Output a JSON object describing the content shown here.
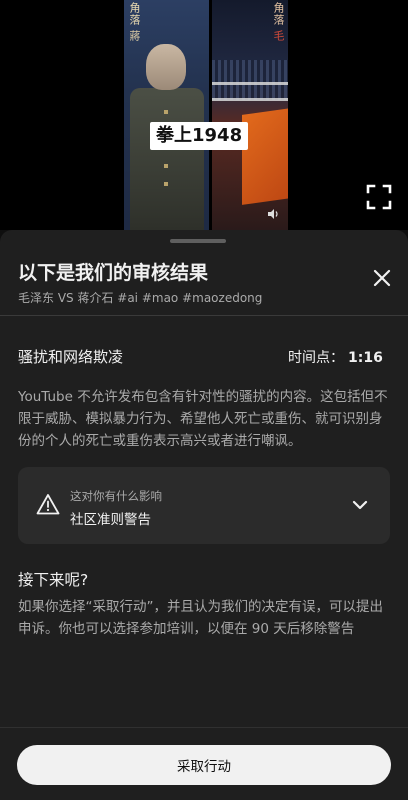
{
  "video": {
    "caption": "拳上1948",
    "left_side_text_top": "角落",
    "left_side_text_mid": "蔣",
    "right_side_text_top": "角落",
    "right_side_text_mid": "毛",
    "fullscreen_icon": "fullscreen-icon",
    "volume_icon": "volume-icon"
  },
  "sheet": {
    "title": "以下是我们的审核结果",
    "subtitle": "毛泽东 VS 蒋介石 #ai #mao #maozedong",
    "close_icon": "close-icon"
  },
  "violation": {
    "title": "骚扰和网络欺凌",
    "timestamp_label": "时间点：",
    "timestamp_value": "1:16",
    "description": "YouTube 不允许发布包含有针对性的骚扰的内容。这包括但不限于威胁、模拟暴力行为、希望他人死亡或重伤、就可识别身份的个人的死亡或重伤表示高兴或者进行嘲讽。"
  },
  "impact": {
    "question": "这对你有什么影响",
    "answer": "社区准则警告",
    "icon": "warning-icon",
    "expand_icon": "chevron-down-icon"
  },
  "next": {
    "title": "接下来呢?",
    "text": "如果你选择“采取行动”，并且认为我们的决定有误，可以提出申诉。你也可以选择参加培训，以便在 90 天后移除警告"
  },
  "action": {
    "button_label": "采取行动"
  },
  "colors": {
    "background": "#0f0f0f",
    "sheet": "#1f1f1f",
    "card": "#2b2b2b",
    "primary_text": "#f1f1f1",
    "secondary_text": "#aaaaaa",
    "button_bg": "#f1f1f1"
  }
}
